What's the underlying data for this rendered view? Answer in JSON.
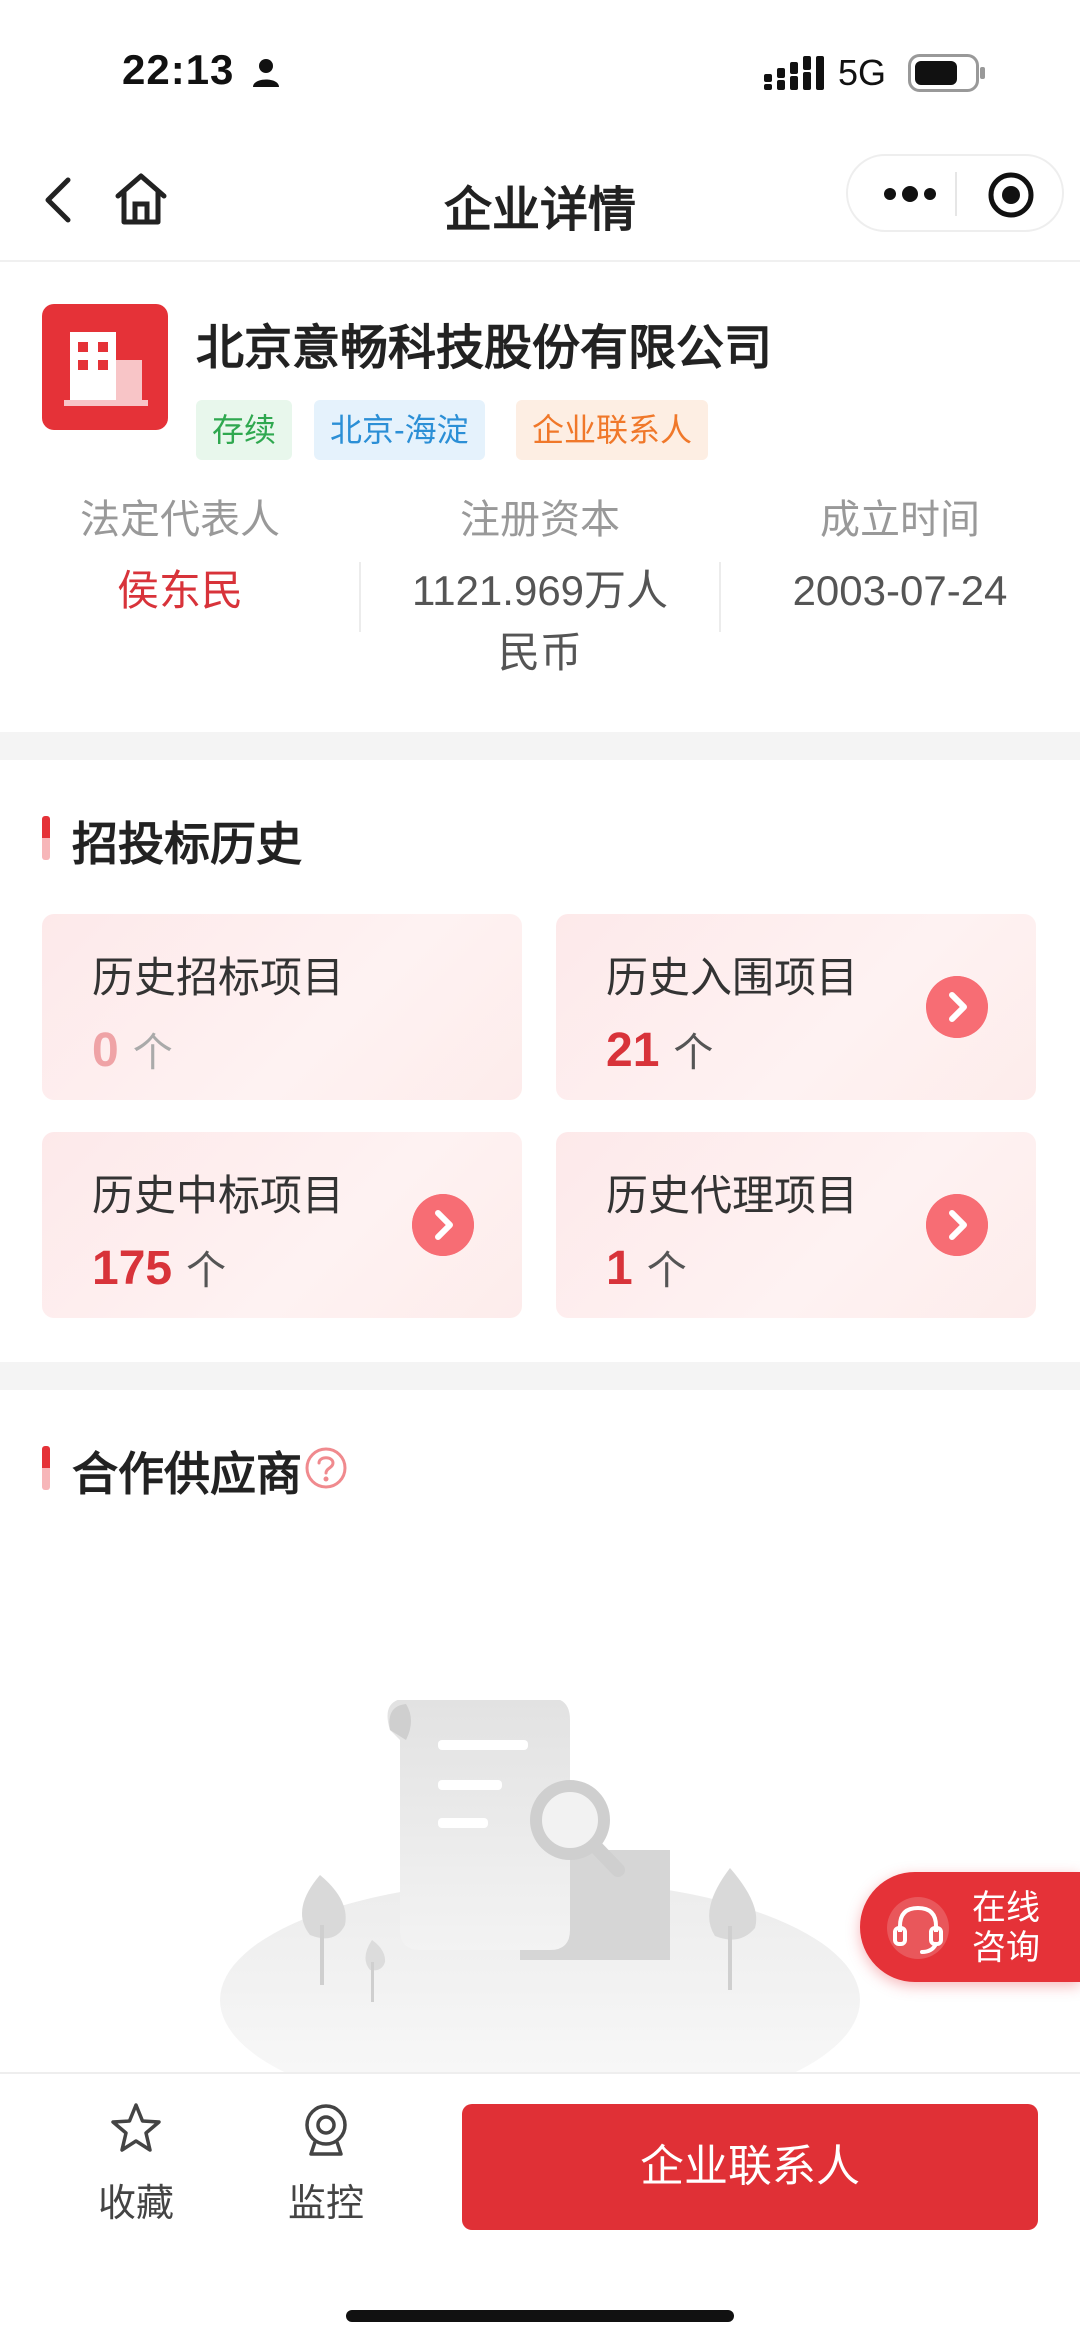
{
  "status_bar": {
    "time": "22:13",
    "network": "5G",
    "icons": [
      "person-icon",
      "signal-icon",
      "battery-icon"
    ]
  },
  "nav": {
    "title": "企业详情",
    "icons": [
      "back-icon",
      "home-icon",
      "more-icon",
      "target-icon"
    ]
  },
  "company": {
    "name": "北京意畅科技股份有限公司",
    "tags": [
      "存续",
      "北京-海淀",
      "企业联系人"
    ],
    "info": [
      {
        "label": "法定代表人",
        "value": "侯东民"
      },
      {
        "label": "注册资本",
        "value": "1121.969万人民币"
      },
      {
        "label": "成立时间",
        "value": "2003-07-24"
      }
    ]
  },
  "bidding": {
    "title": "招投标历史",
    "unit": "个",
    "cards": [
      {
        "title": "历史招标项目",
        "value": "0"
      },
      {
        "title": "历史入围项目",
        "value": "21"
      },
      {
        "title": "历史中标项目",
        "value": "175"
      },
      {
        "title": "历史代理项目",
        "value": "1"
      }
    ]
  },
  "suppliers": {
    "title": "合作供应商",
    "help_icon": "question-icon",
    "empty_illustration": "empty-document-search-illustration"
  },
  "consult": {
    "label": "在线咨询",
    "icon": "headset-icon"
  },
  "bottom_bar": {
    "favorite": {
      "label": "收藏",
      "icon": "star-icon"
    },
    "monitor": {
      "label": "监控",
      "icon": "camera-icon"
    },
    "contact_button": "企业联系人"
  },
  "colors": {
    "brand_red": "#e03036",
    "tag_green": "#2fa84f",
    "tag_blue": "#2b8fd6",
    "tag_orange": "#f0782a"
  }
}
